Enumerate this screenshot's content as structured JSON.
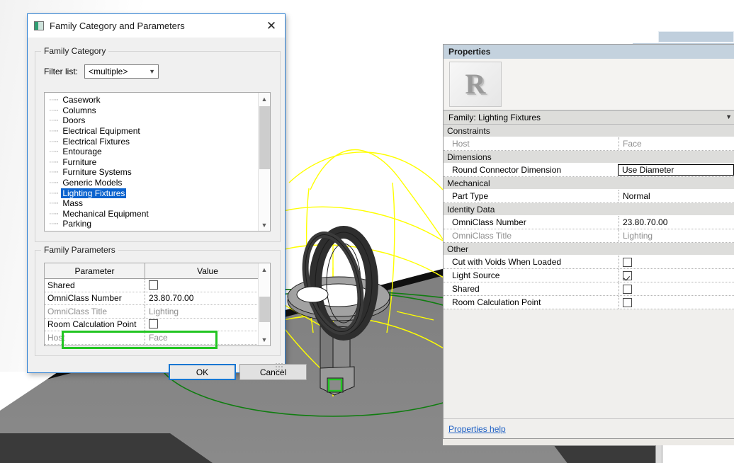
{
  "viewport": {
    "name": "revit-3d-view",
    "description": "3D view of a lighting fixture family with yellow reference planes and green extent circles"
  },
  "dialog": {
    "title": "Family Category and Parameters",
    "icon": "family-category-icon",
    "close_label": "✕",
    "category_group": {
      "legend": "Family Category",
      "filter_label": "Filter list:",
      "filter_value": "<multiple>",
      "items": [
        "Casework",
        "Columns",
        "Doors",
        "Electrical Equipment",
        "Electrical Fixtures",
        "Entourage",
        "Furniture",
        "Furniture Systems",
        "Generic Models",
        "Lighting Fixtures",
        "Mass",
        "Mechanical Equipment",
        "Parking"
      ],
      "selected": "Lighting Fixtures"
    },
    "params_group": {
      "legend": "Family Parameters",
      "columns": [
        "Parameter",
        "Value"
      ],
      "rows": [
        {
          "name": "Shared",
          "value": "",
          "control": "checkbox",
          "checked": false,
          "dim": false
        },
        {
          "name": "OmniClass Number",
          "value": "23.80.70.00",
          "control": "text",
          "dim": false
        },
        {
          "name": "OmniClass Title",
          "value": "Lighting",
          "control": "text",
          "dim": true
        },
        {
          "name": "Room Calculation Point",
          "value": "",
          "control": "checkbox",
          "checked": false,
          "dim": false
        },
        {
          "name": "Host",
          "value": "Face",
          "control": "text",
          "dim": true
        }
      ],
      "highlighted_row": "Host"
    },
    "buttons": {
      "ok": "OK",
      "cancel": "Cancel"
    }
  },
  "properties": {
    "title": "Properties",
    "preview_icon": "revit-logo-R",
    "type_selector": "Family: Lighting Fixtures",
    "groups": [
      {
        "label": "Constraints",
        "rows": [
          {
            "name": "Host",
            "value": "Face",
            "control": "text",
            "dim": true,
            "editing": false
          }
        ]
      },
      {
        "label": "Dimensions",
        "rows": [
          {
            "name": "Round Connector Dimension",
            "value": "Use Diameter",
            "control": "text",
            "dim": false,
            "editing": true
          }
        ]
      },
      {
        "label": "Mechanical",
        "rows": [
          {
            "name": "Part Type",
            "value": "Normal",
            "control": "text",
            "dim": false,
            "editing": false
          }
        ]
      },
      {
        "label": "Identity Data",
        "rows": [
          {
            "name": "OmniClass Number",
            "value": "23.80.70.00",
            "control": "text",
            "dim": false,
            "editing": false
          },
          {
            "name": "OmniClass Title",
            "value": "Lighting",
            "control": "text",
            "dim": true,
            "editing": false
          }
        ]
      },
      {
        "label": "Other",
        "rows": [
          {
            "name": "Cut with Voids When Loaded",
            "value": "",
            "control": "checkbox",
            "checked": false,
            "dim": false
          },
          {
            "name": "Light Source",
            "value": "",
            "control": "checkbox",
            "checked": true,
            "dim": false
          },
          {
            "name": "Shared",
            "value": "",
            "control": "checkbox",
            "checked": false,
            "dim": false
          },
          {
            "name": "Room Calculation Point",
            "value": "",
            "control": "checkbox",
            "checked": false,
            "dim": false
          }
        ]
      }
    ],
    "help_link": "Properties help"
  },
  "colors": {
    "highlight_green": "#22c522",
    "selection_blue": "#0b63ce",
    "reference_yellow": "#ffff00",
    "extent_green": "#107d10",
    "floor_gray": "#808080",
    "properties_header": "#c4d2de"
  }
}
